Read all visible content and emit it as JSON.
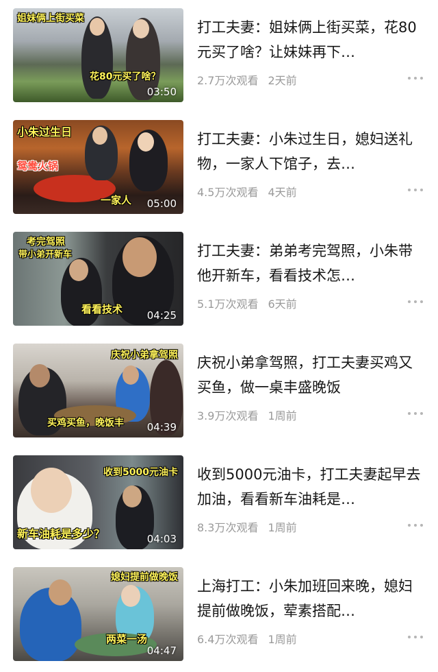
{
  "videos": [
    {
      "title": "打工夫妻：姐妹俩上街买菜，花80元买了啥？让妹妹再下…",
      "views": "2.7万次观看",
      "date": "2天前",
      "duration": "03:50",
      "thumb_caption": "姐妹俩上街买菜",
      "thumb_caption_2": "",
      "thumb_bottom": "花80元买了啥？",
      "thumb_red": ""
    },
    {
      "title": "打工夫妻：小朱过生日，媳妇送礼物，一家人下馆子，去…",
      "views": "4.5万次观看",
      "date": "4天前",
      "duration": "05:00",
      "thumb_caption": "小朱过生日",
      "thumb_caption_2": "",
      "thumb_bottom": "一家人",
      "thumb_red": "鸳鸯火锅"
    },
    {
      "title": "打工夫妻：弟弟考完驾照，小朱带他开新车，看看技术怎…",
      "views": "5.1万次观看",
      "date": "6天前",
      "duration": "04:25",
      "thumb_caption": "考完驾照",
      "thumb_caption_2": "带小弟开新车",
      "thumb_bottom": "看看技术",
      "thumb_red": ""
    },
    {
      "title": "庆祝小弟拿驾照，打工夫妻买鸡又买鱼，做一桌丰盛晚饭",
      "views": "3.9万次观看",
      "date": "1周前",
      "duration": "04:39",
      "thumb_caption": "庆祝小弟拿驾照",
      "thumb_caption_2": "",
      "thumb_bottom": "买鸡买鱼，晚饭丰",
      "thumb_red": ""
    },
    {
      "title": "收到5000元油卡，打工夫妻起早去加油，看看新车油耗是…",
      "views": "8.3万次观看",
      "date": "1周前",
      "duration": "04:03",
      "thumb_caption": "收到5000元油卡",
      "thumb_caption_2": "",
      "thumb_bottom": "新车油耗是多少？",
      "thumb_red": ""
    },
    {
      "title": "上海打工：小朱加班回来晚，媳妇提前做晚饭，荤素搭配…",
      "views": "6.4万次观看",
      "date": "1周前",
      "duration": "04:47",
      "thumb_caption": "媳妇提前做晚饭",
      "thumb_caption_2": "",
      "thumb_bottom": "两菜一汤",
      "thumb_red": ""
    }
  ],
  "icons": {
    "more": "more-dots-icon"
  },
  "colors": {
    "title_text": "#161616",
    "meta_text": "#9a9a9a",
    "caption_yellow": "#fff35a"
  }
}
